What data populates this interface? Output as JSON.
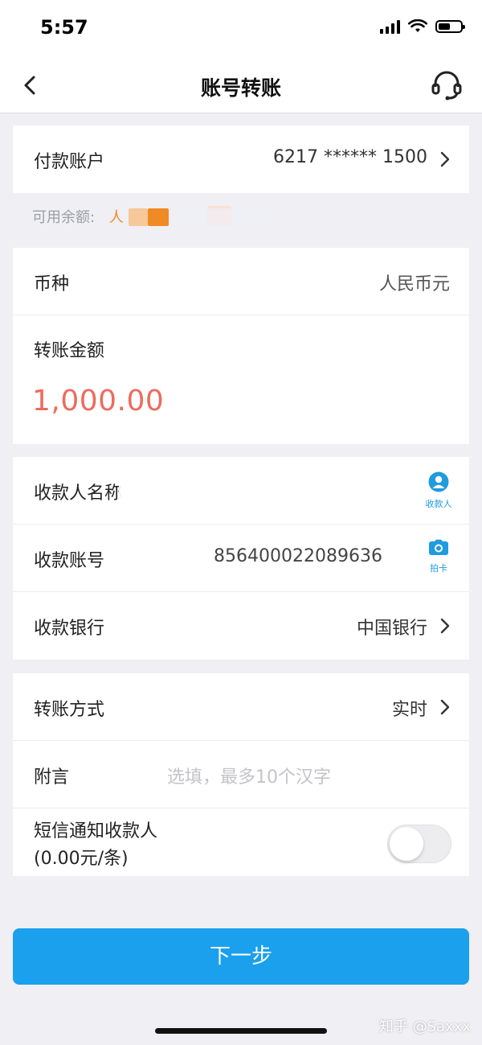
{
  "status_bar": {
    "time": "5:57",
    "battery_level": 0.55
  },
  "nav": {
    "title": "账号转账",
    "back_icon": "chevron-left-icon",
    "service_icon": "headset-icon"
  },
  "payer": {
    "label": "付款账户",
    "account": "6217 ****** 1500"
  },
  "balance": {
    "label": "可用余额:",
    "value_prefix": "人"
  },
  "currency": {
    "label": "币种",
    "value": "人民币元"
  },
  "amount": {
    "label": "转账金额",
    "value": "1,000.00"
  },
  "payee": {
    "name_label": "收款人名称",
    "name_icon_label": "收款人",
    "account_label": "收款账号",
    "account_value": "856400022089636",
    "account_icon_label": "拍卡",
    "bank_label": "收款银行",
    "bank_value": "中国银行"
  },
  "method": {
    "label": "转账方式",
    "value": "实时"
  },
  "note": {
    "label": "附言",
    "placeholder": "选填，最多10个汉字"
  },
  "sms": {
    "label_line1": "短信通知收款人",
    "label_line2": "(0.00元/条)",
    "enabled": false
  },
  "next_button": {
    "label": "下一步"
  },
  "watermark": "知乎 @Saxxx",
  "colors": {
    "accent": "#1aa0ec",
    "amount": "#ee6b5e",
    "background": "#efeff4",
    "icon_blue": "#1f9be0"
  }
}
